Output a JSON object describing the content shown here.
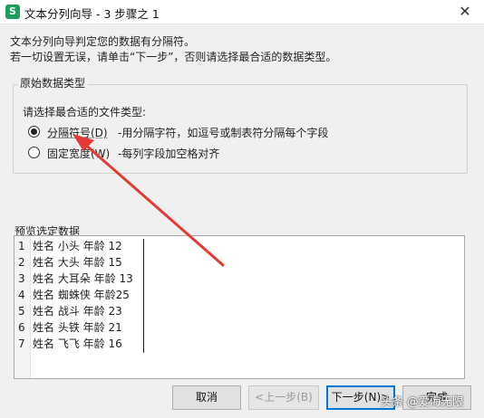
{
  "window": {
    "title": "文本分列向导 - 3 步骤之 1",
    "app_icon_letter": "S",
    "close_symbol": "✕"
  },
  "description": {
    "line1": "文本分列向导判定您的数据有分隔符。",
    "line2": "若一切设置无误，请单击“下一步”，否则请选择最合适的数据类型。"
  },
  "group": {
    "title": "原始数据类型",
    "prompt": "请选择最合适的文件类型:",
    "options": [
      {
        "label": "分隔符号(D)",
        "description": "-用分隔字符，如逗号或制表符分隔每个字段",
        "checked": true
      },
      {
        "label": "固定宽度(W)",
        "description": "-每列字段加空格对齐",
        "checked": false
      }
    ]
  },
  "preview": {
    "title": "预览选定数据",
    "rows": [
      {
        "num": "1",
        "text": "姓名 小头 年龄 12"
      },
      {
        "num": "2",
        "text": "姓名 大头 年龄 15"
      },
      {
        "num": "3",
        "text": "姓名 大耳朵 年龄 13"
      },
      {
        "num": "4",
        "text": "姓名 蜘蛛侠 年龄25"
      },
      {
        "num": "5",
        "text": "姓名 战斗 年龄 23"
      },
      {
        "num": "6",
        "text": "姓名 头铁 年龄 21"
      },
      {
        "num": "7",
        "text": "姓名 飞飞 年龄 16"
      }
    ]
  },
  "buttons": {
    "cancel": "取消",
    "prev": "<上一步(B)",
    "next": "下一步(N)>",
    "finish": "完成"
  },
  "watermark": "头条 @爱海无限",
  "colors": {
    "annotation_arrow": "#e53935",
    "app_icon": "#1aa05a",
    "default_button_border": "#0078d7"
  }
}
